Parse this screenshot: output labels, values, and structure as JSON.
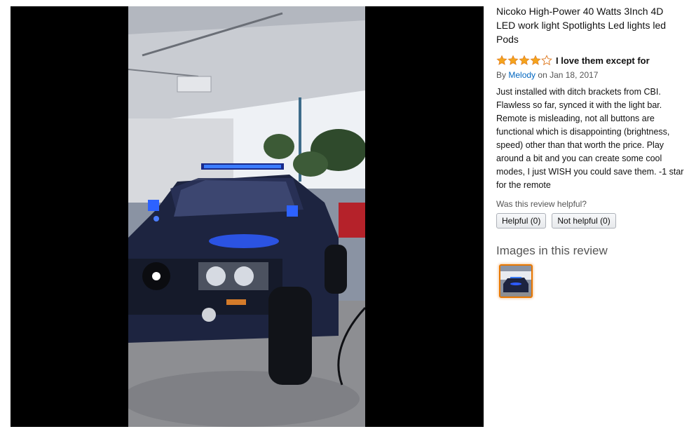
{
  "product": {
    "title": "Nicoko High-Power 40 Watts 3Inch 4D LED work light Spotlights Led lights led Pods"
  },
  "review": {
    "rating": 4,
    "max_rating": 5,
    "title": "I love them except for",
    "by_prefix": "By",
    "author": "Melody",
    "date_text": "on Jan 18, 2017",
    "body": "Just installed with ditch brackets from CBI. Flawless so far, synced it with the light bar. Remote is misleading, not all buttons are functional which is disappointing (brightness, speed) other than that worth the price. Play around a bit and you can create some cool modes, I just WISH you could save them. -1 star for the remote",
    "helpful_question": "Was this review helpful?",
    "helpful_button": "Helpful (0)",
    "not_helpful_button": "Not helpful (0)"
  },
  "images_section": {
    "heading": "Images in this review"
  },
  "colors": {
    "star_filled": "#f4a41c",
    "star_empty": "#ffffff",
    "star_outline": "#de7921",
    "link": "#0066c0",
    "thumb_border": "#e77600",
    "viewer_bg": "#000000"
  }
}
